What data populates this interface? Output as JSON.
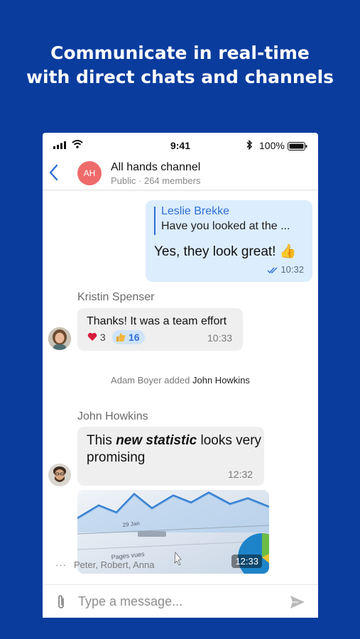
{
  "headline": {
    "line1": "Communicate in real-time",
    "line2": "with direct chats and channels"
  },
  "status_bar": {
    "time": "9:41",
    "battery": "100%"
  },
  "channel": {
    "avatar_initials": "AH",
    "title": "All hands channel",
    "subtitle": "Public · 264 members"
  },
  "messages": {
    "outgoing": {
      "quote_author": "Leslie Brekke",
      "quote_text": "Have you looked at the ...",
      "text": "Yes, they look great! 👍",
      "time": "10:32"
    },
    "kristin": {
      "sender": "Kristin Spenser",
      "text": "Thanks! It was a team effort",
      "time": "10:33",
      "heart_count": "3",
      "thumbs_count": "16"
    },
    "system_note": {
      "actor": "Adam Boyer",
      "action": "added",
      "target": "John Howkins"
    },
    "john": {
      "sender": "John Howkins",
      "text_pre": "This ",
      "text_em": "new statistic",
      "text_post": " looks very",
      "text_line2": "promising",
      "time": "12:32",
      "media_time": "12:33",
      "chart_label_date": "29 Jan",
      "chart_label_views": "Pages vues"
    }
  },
  "typing_indicator": {
    "dots": "···",
    "names": "Peter, Robert, Anna"
  },
  "composer": {
    "placeholder": "Type a message..."
  },
  "colors": {
    "background": "#0a3c9e",
    "accent": "#2f6fd6",
    "outgoing_bubble": "#dcedfd",
    "incoming_bubble": "#efefef",
    "avatar_ah": "#ee6b6b",
    "heart": "#d81b3c"
  },
  "icons": {
    "back": "chevron-left-icon",
    "attach": "paperclip-icon",
    "send": "send-icon",
    "read": "double-check-icon",
    "heart": "heart-icon",
    "thumbs": "thumbs-up-icon"
  }
}
